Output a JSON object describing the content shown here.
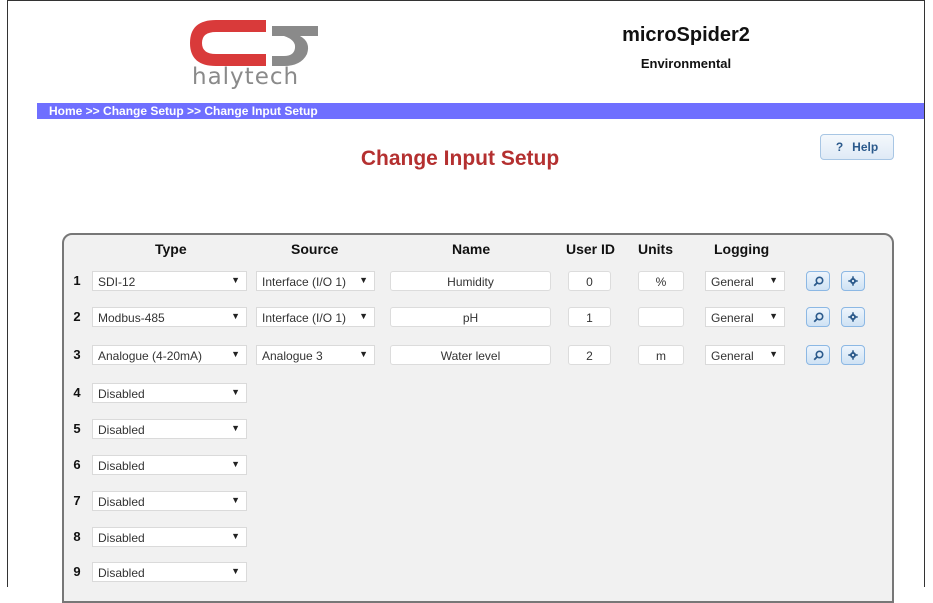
{
  "header": {
    "logo_text": "halytech",
    "device_name": "microSpider2",
    "device_subtitle": "Environmental",
    "brand_red": "#d93a3a",
    "brand_grey": "#8a8a8a"
  },
  "breadcrumb": [
    "Home",
    "Change Setup",
    "Change Input Setup"
  ],
  "breadcrumb_separator": " >> ",
  "help_button": {
    "icon": "question-icon",
    "glyph": "?",
    "label": "Help"
  },
  "page_title": "Change Input Setup",
  "table": {
    "columns": [
      "Type",
      "Source",
      "Name",
      "User ID",
      "Units",
      "Logging"
    ],
    "rows": [
      {
        "num": "1",
        "type": "SDI-12",
        "source": "Interface (I/O 1)",
        "name": "Humidity",
        "user_id": "0",
        "units": "%",
        "logging": "General"
      },
      {
        "num": "2",
        "type": "Modbus-485",
        "source": "Interface (I/O 1)",
        "name": "pH",
        "user_id": "1",
        "units": "",
        "logging": "General"
      },
      {
        "num": "3",
        "type": "Analogue (4-20mA)",
        "source": "Analogue 3",
        "name": "Water level",
        "user_id": "2",
        "units": "m",
        "logging": "General"
      },
      {
        "num": "4",
        "type": "Disabled"
      },
      {
        "num": "5",
        "type": "Disabled"
      },
      {
        "num": "6",
        "type": "Disabled"
      },
      {
        "num": "7",
        "type": "Disabled"
      },
      {
        "num": "8",
        "type": "Disabled"
      },
      {
        "num": "9",
        "type": "Disabled"
      }
    ],
    "row_buttons": [
      "search-icon",
      "gear-icon"
    ]
  },
  "colors": {
    "nav_bar": "#6f6fff",
    "title": "#b43030",
    "panel_bg": "#f1f1f1"
  }
}
